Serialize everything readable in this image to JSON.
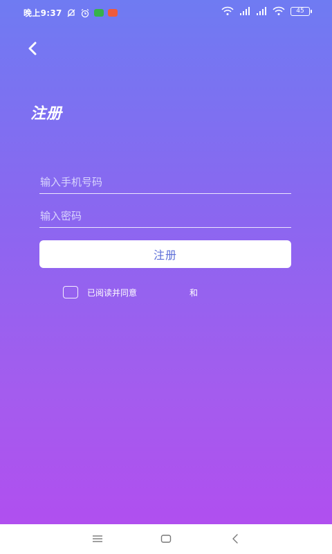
{
  "status_bar": {
    "time": "晚上9:37",
    "battery": "45",
    "app_icon_colors": [
      "#36b24a",
      "#f05a3b"
    ]
  },
  "header": {
    "title": "注册",
    "back_icon": "chevron-left-icon"
  },
  "form": {
    "phone_placeholder": "输入手机号码",
    "phone_value": "",
    "password_placeholder": "输入密码",
    "password_value": "",
    "submit_label": "注册"
  },
  "agreement": {
    "checked": false,
    "prefix": "已阅读并同意",
    "link1": "",
    "joiner": "和",
    "link2": ""
  },
  "colors": {
    "gradient_top": "#6f7bf2",
    "gradient_bottom": "#b04fef",
    "button_text": "#5d6fd8",
    "link": "#7f8ff0"
  },
  "nav_bar": {
    "icons": [
      "menu-icon",
      "home-icon",
      "back-icon"
    ]
  }
}
